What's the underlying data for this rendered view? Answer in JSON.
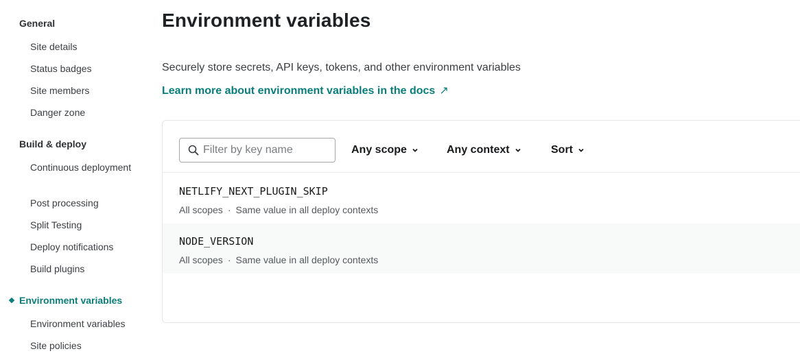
{
  "sidebar": {
    "general": {
      "title": "General",
      "items": [
        "Site details",
        "Status badges",
        "Site members",
        "Danger zone"
      ]
    },
    "build_deploy": {
      "title": "Build & deploy",
      "items": [
        "Continuous deployment",
        "Post processing",
        "Split Testing",
        "Deploy notifications",
        "Build plugins"
      ]
    },
    "environment": {
      "title": "Environment variables",
      "items": [
        "Environment variables",
        "Site policies"
      ]
    }
  },
  "main": {
    "title": "Environment variables",
    "subtitle": "Securely store secrets, API keys, tokens, and other environment variables",
    "docs_link": "Learn more about environment variables in the docs",
    "docs_link_icon": "↗"
  },
  "toolbar": {
    "search_placeholder": "Filter by key name",
    "scope_label": "Any scope",
    "context_label": "Any context",
    "sort_label": "Sort"
  },
  "variables": [
    {
      "key": "NETLIFY_NEXT_PLUGIN_SKIP",
      "scope": "All scopes",
      "separator": "·",
      "context": "Same value in all deploy contexts"
    },
    {
      "key": "NODE_VERSION",
      "scope": "All scopes",
      "separator": "·",
      "context": "Same value in all deploy contexts"
    }
  ],
  "colors": {
    "accent": "#0a7e7a",
    "text": "#181a1c",
    "muted": "#55595d"
  }
}
